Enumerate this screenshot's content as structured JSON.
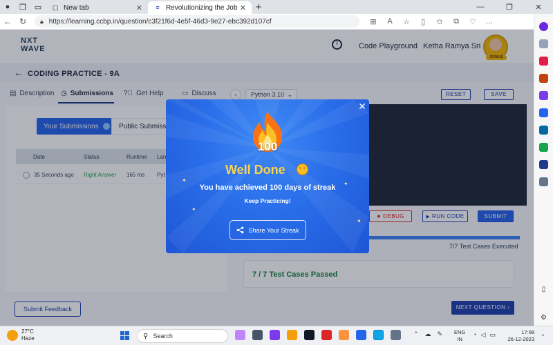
{
  "browser": {
    "tabs": [
      {
        "title": "New tab",
        "active": false
      },
      {
        "title": "Revolutionizing the Job Market |",
        "active": true
      }
    ],
    "url": "https://learning.ccbp.in/question/c3f21f6d-4e5f-46d3-9e27-ebc392d107cf",
    "new_tab_label": "+"
  },
  "header": {
    "logo_line1": "NXT",
    "logo_line2": "WAVE",
    "code_playground": "Code Playground",
    "user_name": "Ketha Ramya Sri",
    "avatar_badge": "GENIUS"
  },
  "practice": {
    "title": "CODING PRACTICE - 9A",
    "tabs": [
      "Description",
      "Submissions",
      "Get Help",
      "Discuss"
    ],
    "language": "Python 3.10",
    "reset_label": "RESET",
    "save_label": "SAVE"
  },
  "submissions": {
    "your_label": "Your Submissions",
    "public_label": "Public Submissio",
    "columns": [
      "Date",
      "Status",
      "Runtime",
      "Lan"
    ],
    "rows": [
      {
        "date": "35 Seconds ago",
        "status": "Right Answer",
        "runtime": "165 ms",
        "lang": "Pyt"
      }
    ]
  },
  "editor_actions": {
    "debug_label": "DEBUG",
    "run_label": "RUN CODE",
    "submit_label": "SUBMIT",
    "progress_fraction": 1.0,
    "tests_executed": "7/7 Test Cases Executed",
    "tests_passed": "7 / 7 Test Cases Passed"
  },
  "footer": {
    "feedback_label": "Submit Feedback",
    "next_label": "NEXT QUESTION"
  },
  "modal": {
    "streak_number": "100",
    "heading": "Well Done",
    "message": "You have achieved 100 days of streak",
    "sub_message": "Keep Practicing!",
    "share_label": "Share Your Streak",
    "close_symbol": "✕"
  },
  "taskbar": {
    "temperature": "27°C",
    "weather": "Haze",
    "search_placeholder": "Search",
    "lang_line1": "ENG",
    "lang_line2": "IN",
    "time": "17:08",
    "date": "26-12-2023"
  },
  "colors": {
    "accent": "#2563eb",
    "modal_blue": "#2a6eea",
    "success": "#16a34a",
    "heading_gold": "#fcd34d"
  }
}
